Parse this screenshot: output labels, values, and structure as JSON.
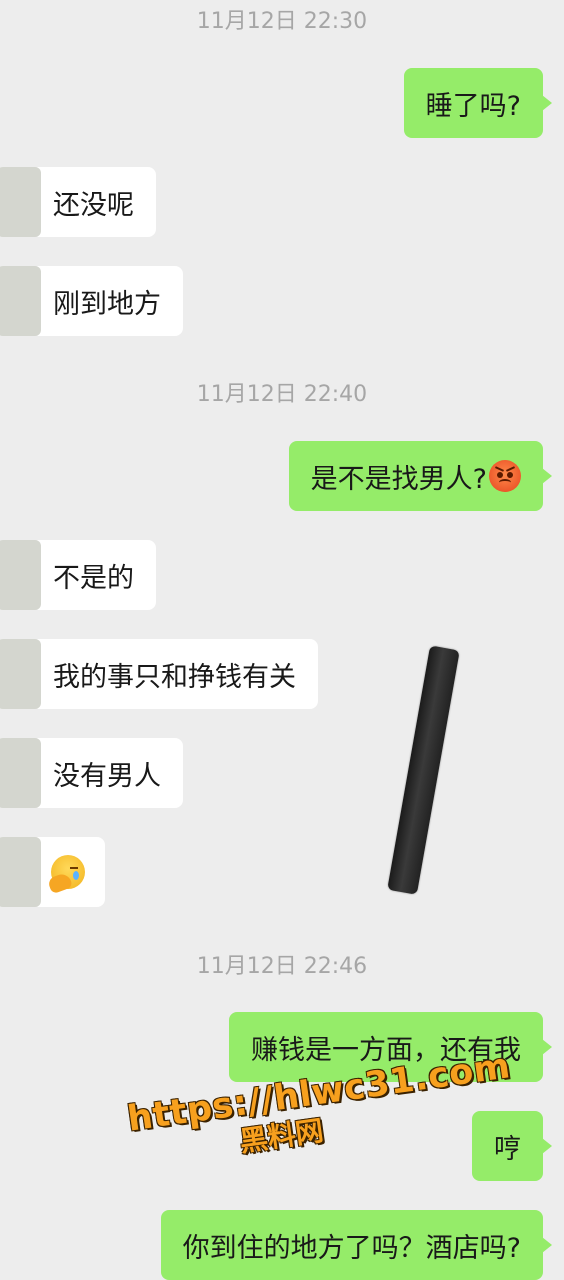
{
  "chat": {
    "timestamps": [
      "11月12日 22:30",
      "11月12日 22:40",
      "11月12日 22:46"
    ],
    "messages": [
      {
        "side": "out",
        "text": "睡了吗?"
      },
      {
        "side": "in",
        "text": "还没呢"
      },
      {
        "side": "in",
        "text": "刚到地方"
      },
      {
        "side": "out",
        "text": "是不是找男人?",
        "emoji": "angry-face-icon"
      },
      {
        "side": "in",
        "text": "不是的"
      },
      {
        "side": "in",
        "text": "我的事只和挣钱有关"
      },
      {
        "side": "in",
        "text": "没有男人"
      },
      {
        "side": "in",
        "text": "",
        "emoji": "facepalm-icon"
      },
      {
        "side": "out",
        "text": "赚钱是一方面，还有我"
      },
      {
        "side": "out",
        "text": "哼"
      },
      {
        "side": "out",
        "text": "你到住的地方了吗？酒店吗?"
      }
    ]
  },
  "watermark": {
    "url": "https://hlwc31.com",
    "name": "黑料网"
  },
  "colors": {
    "background": "#ededed",
    "outgoing_bubble": "#95ec69",
    "incoming_bubble": "#ffffff",
    "timestamp": "#a6a6a6",
    "watermark": "#f7a01e"
  }
}
